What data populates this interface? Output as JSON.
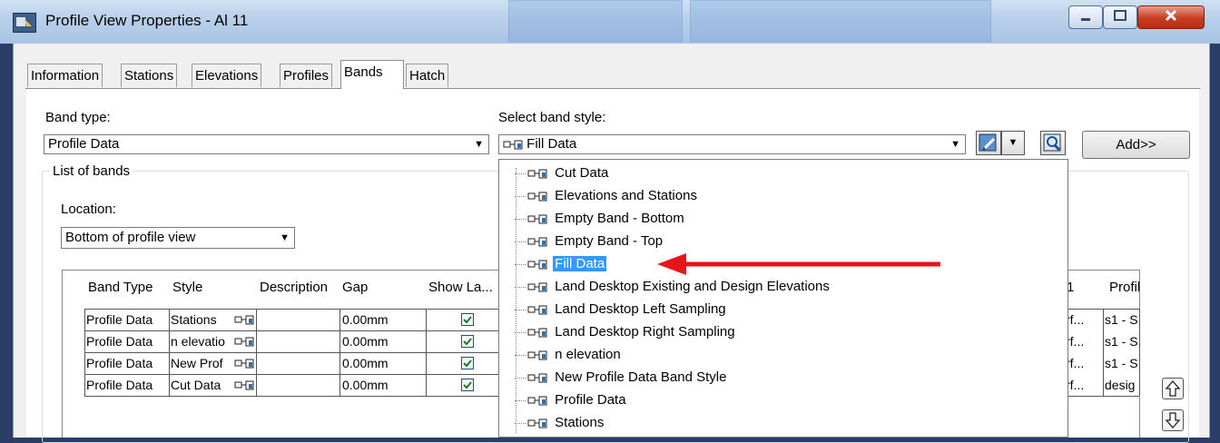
{
  "window": {
    "title": "Profile View Properties - Al 11"
  },
  "tabs": [
    "Information",
    "Stations",
    "Elevations",
    "Profiles",
    "Bands",
    "Hatch"
  ],
  "active_tab": "Bands",
  "band_type": {
    "label": "Band type:",
    "value": "Profile Data"
  },
  "band_style": {
    "label": "Select band style:",
    "value": "Fill Data"
  },
  "add_button": "Add>>",
  "list_of_bands": {
    "title": "List of bands",
    "location_label": "Location:",
    "location_value": "Bottom of profile view",
    "columns": [
      "Band Type",
      "Style",
      "Description",
      "Gap",
      "Show La..."
    ],
    "hidden_col_a": "1",
    "hidden_col_b": "Profil",
    "rows": [
      {
        "type": "Profile Data",
        "style": "Stations",
        "gap": "0.00mm",
        "show": true,
        "colA": "rf...",
        "colB": "s1 - S"
      },
      {
        "type": "Profile Data",
        "style": "n elevatio",
        "gap": "0.00mm",
        "show": true,
        "colA": "rf...",
        "colB": "s1 - S"
      },
      {
        "type": "Profile Data",
        "style": "New Prof",
        "gap": "0.00mm",
        "show": true,
        "colA": "rf...",
        "colB": "s1 - S"
      },
      {
        "type": "Profile Data",
        "style": "Cut Data",
        "gap": "0.00mm",
        "show": true,
        "colA": "rf...",
        "colB": "desig"
      }
    ]
  },
  "dropdown_items": [
    "Cut Data",
    "Elevations and Stations",
    "Empty Band - Bottom",
    "Empty Band - Top",
    "Fill Data",
    "Land Desktop Existing and Design Elevations",
    "Land Desktop Left Sampling",
    "Land Desktop Right Sampling",
    "n elevation",
    "New Profile Data Band Style",
    "Profile Data",
    "Stations"
  ],
  "selected_dropdown_item": "Fill Data",
  "colors": {
    "selection": "#3399ff",
    "annotation_arrow": "#e8141a",
    "checkbox_mark": "#1f7a1f",
    "close_button": "#c73d24"
  }
}
